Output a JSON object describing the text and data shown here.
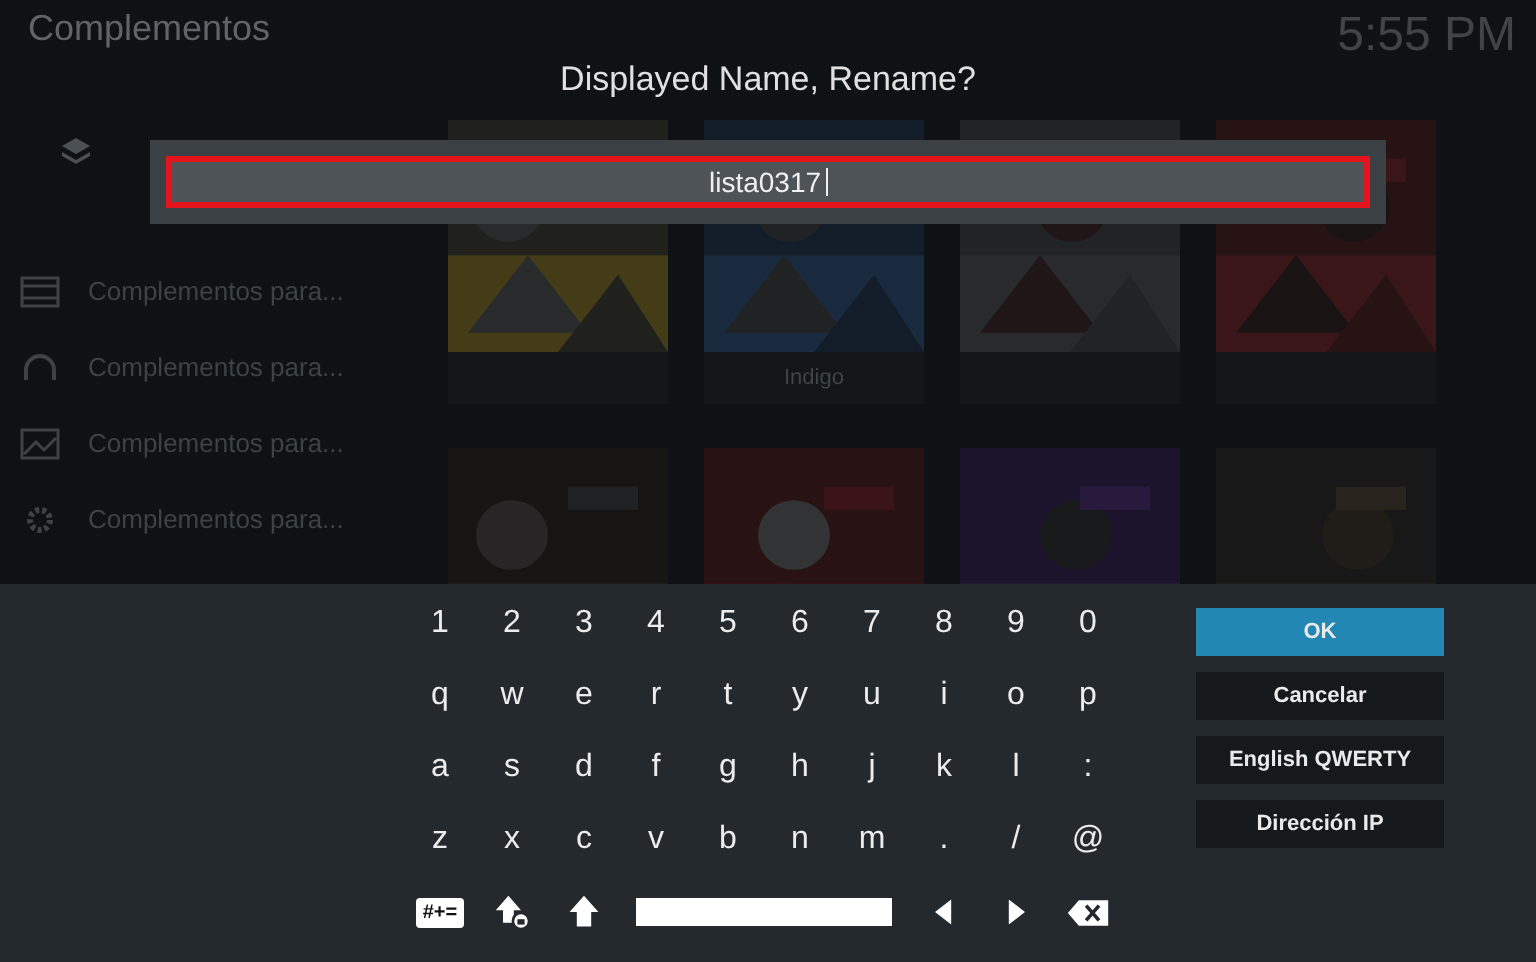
{
  "header": {
    "title": "Complementos",
    "clock": "5:55 PM"
  },
  "sidebar": {
    "items": [
      {
        "label": "Complementos para..."
      },
      {
        "label": "Complementos para..."
      },
      {
        "label": "Complementos para..."
      },
      {
        "label": "Complementos para..."
      }
    ]
  },
  "tiles": [
    {
      "kind": "picture"
    },
    {
      "kind": "picture",
      "label": "Indigo"
    },
    {
      "kind": "picture"
    },
    {
      "kind": "picture"
    },
    {
      "kind": "picture"
    },
    {
      "kind": "picture"
    },
    {
      "kind": "picture"
    },
    {
      "kind": "picture"
    }
  ],
  "dialog": {
    "title": "Displayed Name, Rename?",
    "value": "lista0317"
  },
  "keyboard": {
    "rows": [
      [
        "1",
        "2",
        "3",
        "4",
        "5",
        "6",
        "7",
        "8",
        "9",
        "0"
      ],
      [
        "q",
        "w",
        "e",
        "r",
        "t",
        "y",
        "u",
        "i",
        "o",
        "p"
      ],
      [
        "a",
        "s",
        "d",
        "f",
        "g",
        "h",
        "j",
        "k",
        "l",
        ":"
      ],
      [
        "z",
        "x",
        "c",
        "v",
        "b",
        "n",
        "m",
        ".",
        "/",
        "@"
      ]
    ],
    "bottom_keys": [
      {
        "kind": "symbols",
        "label": "#+="
      },
      {
        "kind": "caps_lock"
      },
      {
        "kind": "shift"
      },
      {
        "kind": "space"
      },
      {
        "kind": "left"
      },
      {
        "kind": "right"
      },
      {
        "kind": "backspace"
      }
    ]
  },
  "buttons": [
    {
      "label": "OK",
      "selected": true
    },
    {
      "label": "Cancelar",
      "selected": false
    },
    {
      "label": "English QWERTY",
      "selected": false
    },
    {
      "label": "Dirección IP",
      "selected": false
    }
  ]
}
